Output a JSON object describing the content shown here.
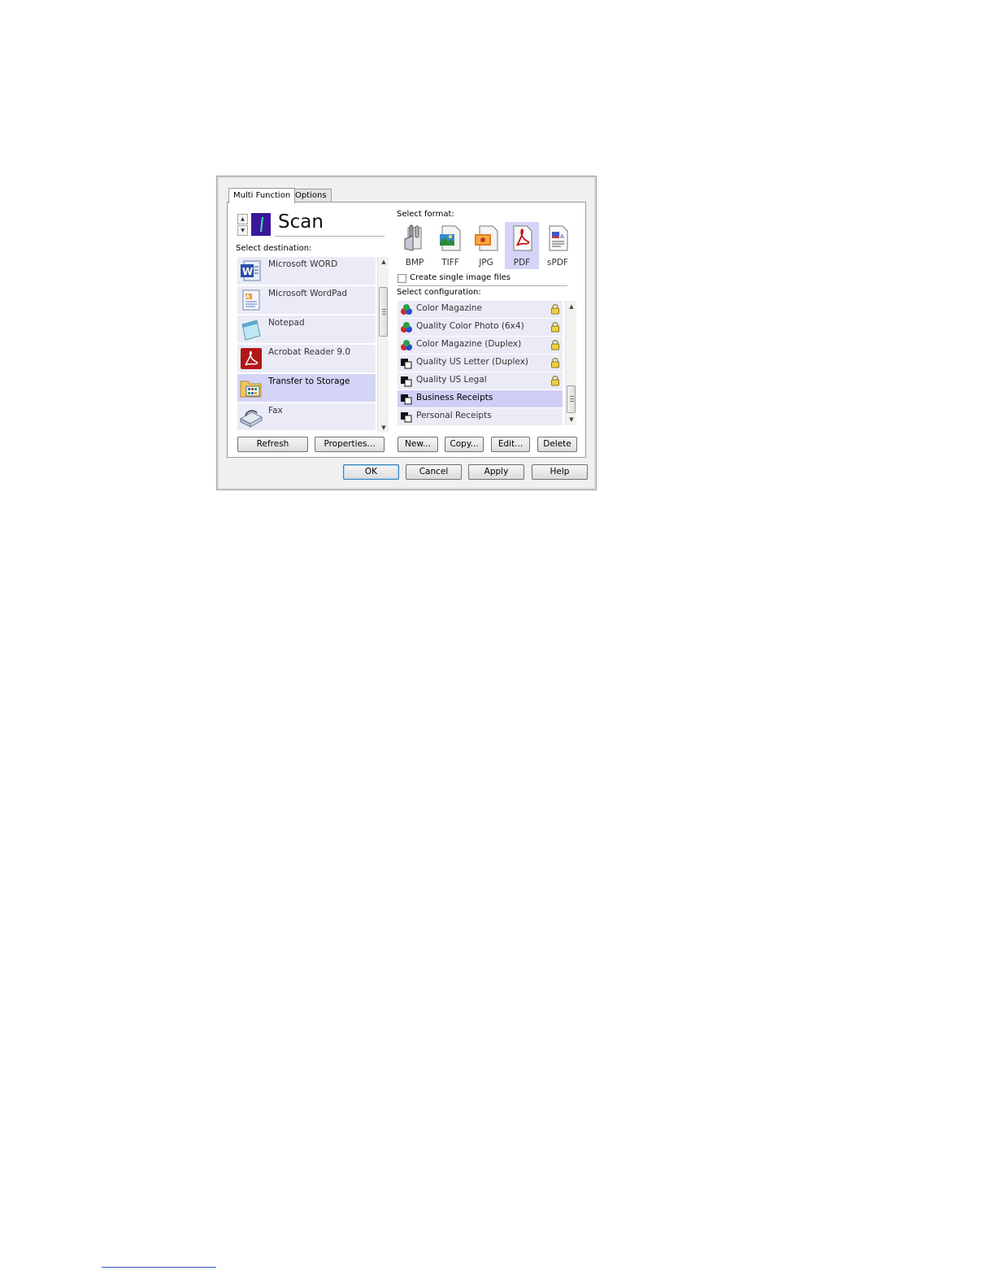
{
  "tabs": [
    {
      "label": "Multi Function"
    },
    {
      "label": "Options"
    }
  ],
  "header": {
    "title": "Scan"
  },
  "destination": {
    "label": "Select destination:",
    "items": [
      {
        "label": "Microsoft WORD",
        "icon": "word-icon"
      },
      {
        "label": "Microsoft WordPad",
        "icon": "wordpad-icon"
      },
      {
        "label": "Notepad",
        "icon": "notepad-icon"
      },
      {
        "label": "Acrobat Reader 9.0",
        "icon": "acrobat-icon"
      },
      {
        "label": "Transfer to Storage",
        "icon": "storage-folder-icon",
        "selected": true
      },
      {
        "label": "Fax",
        "icon": "fax-icon"
      }
    ],
    "buttons": {
      "refresh": "Refresh",
      "properties": "Properties..."
    }
  },
  "format": {
    "label": "Select format:",
    "items": [
      {
        "label": "BMP",
        "icon": "bmp-icon"
      },
      {
        "label": "TIFF",
        "icon": "tiff-icon"
      },
      {
        "label": "JPG",
        "icon": "jpg-icon"
      },
      {
        "label": "PDF",
        "icon": "pdf-icon",
        "selected": true
      },
      {
        "label": "sPDF",
        "icon": "spdf-icon"
      }
    ],
    "single_image_label": "Create single image files"
  },
  "configuration": {
    "label": "Select configuration:",
    "items": [
      {
        "label": "Color Magazine",
        "icon": "color-config-icon",
        "locked": true
      },
      {
        "label": "Quality Color Photo (6x4)",
        "icon": "color-config-icon",
        "locked": true
      },
      {
        "label": "Color Magazine (Duplex)",
        "icon": "color-config-icon",
        "locked": true
      },
      {
        "label": "Quality US Letter (Duplex)",
        "icon": "bw-config-icon",
        "locked": true
      },
      {
        "label": "Quality US Legal",
        "icon": "bw-config-icon",
        "locked": true
      },
      {
        "label": "Business Receipts",
        "icon": "bw-config-icon",
        "selected": true
      },
      {
        "label": "Personal Receipts",
        "icon": "bw-config-icon"
      }
    ],
    "buttons": {
      "new": "New...",
      "copy": "Copy...",
      "edit": "Edit...",
      "delete": "Delete"
    }
  },
  "footer_buttons": {
    "ok": "OK",
    "cancel": "Cancel",
    "apply": "Apply",
    "help": "Help"
  },
  "colors": {
    "selected_row": "#d4d4f6",
    "row": "#ebebf7",
    "default_button_border": "#3c7fb1"
  }
}
